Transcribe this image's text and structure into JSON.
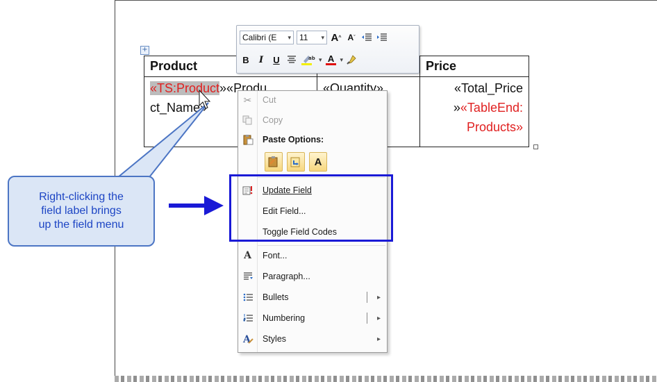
{
  "table": {
    "headers": [
      "Product",
      "",
      "Price"
    ],
    "row": {
      "c1_red": "«TS:Product",
      "c1_rest_top": "»«Produ",
      "c1_rest_bottom": "ct_Name»",
      "c2": "«Quantity»",
      "c3_line1": "«Total_Price",
      "c3_line2_black": "»",
      "c3_line2_red": "«TableEnd:",
      "c3_line3_red": "Products»"
    }
  },
  "mini_toolbar": {
    "font_name": "Calibri (E",
    "font_size": "11",
    "grow_label": "A",
    "shrink_label": "A",
    "bold": "B",
    "italic": "I",
    "underline": "U",
    "font_color_label": "A"
  },
  "menu": {
    "cut": "Cut",
    "copy": "Copy",
    "paste_options": "Paste Options:",
    "paste_text_label": "A",
    "update_field": "Update Field",
    "edit_field": "Edit Field...",
    "toggle_field_codes": "Toggle Field Codes",
    "font": "Font...",
    "paragraph": "Paragraph...",
    "bullets": "Bullets",
    "numbering": "Numbering",
    "styles": "Styles"
  },
  "callout": {
    "line1": "Right-clicking the",
    "line2": "field label brings",
    "line3": "up the field menu"
  },
  "colors": {
    "accent_blue": "#1a1ad6",
    "field_red": "#e02020",
    "callout_fill": "#dbe6f6",
    "callout_text": "#1d45c4"
  }
}
